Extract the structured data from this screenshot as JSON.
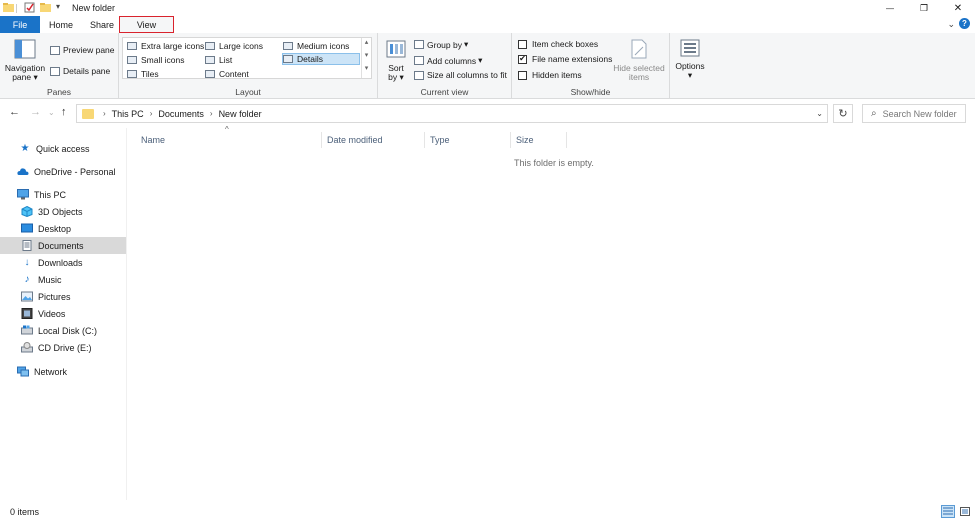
{
  "window": {
    "title": "New folder",
    "minimize": "—",
    "restore": "❐",
    "close": "✕"
  },
  "tabs": [
    {
      "label": "File"
    },
    {
      "label": "Home"
    },
    {
      "label": "Share"
    },
    {
      "label": "View"
    }
  ],
  "ribbon": {
    "collapse": "⌄",
    "help": "?",
    "panes": {
      "label": "Panes",
      "navigation_pane": "Navigation",
      "navigation_pane_2": "pane",
      "preview_pane": "Preview pane",
      "details_pane": "Details pane"
    },
    "layout": {
      "label": "Layout",
      "items": [
        {
          "label": "Extra large icons"
        },
        {
          "label": "Large icons"
        },
        {
          "label": "Medium icons"
        },
        {
          "label": "Small icons"
        },
        {
          "label": "List"
        },
        {
          "label": "Details"
        },
        {
          "label": "Tiles"
        },
        {
          "label": "Content"
        }
      ],
      "selected": "Details"
    },
    "current_view": {
      "label": "Current view",
      "sort_by": "Sort",
      "sort_by_2": "by",
      "group_by": "Group by",
      "add_columns": "Add columns",
      "size_columns": "Size all columns to fit"
    },
    "show_hide": {
      "label": "Show/hide",
      "item_check_boxes": "Item check boxes",
      "item_check_boxes_checked": false,
      "file_name_extensions": "File name extensions",
      "file_name_extensions_checked": true,
      "hidden_items": "Hidden items",
      "hidden_items_checked": false,
      "hide_selected": "Hide selected",
      "hide_selected_2": "items"
    },
    "options": {
      "label": "Options"
    }
  },
  "address": {
    "crumbs": [
      "This PC",
      "Documents",
      "New folder"
    ],
    "search_placeholder": "Search New folder"
  },
  "nav_pane": {
    "items": [
      {
        "label": "Quick access",
        "icon": "star-icon"
      },
      {
        "label": "OneDrive - Personal",
        "icon": "cloud-icon"
      },
      {
        "label": "This PC",
        "icon": "computer-icon"
      },
      {
        "label": "3D Objects",
        "icon": "cube-icon"
      },
      {
        "label": "Desktop",
        "icon": "desktop-icon"
      },
      {
        "label": "Documents",
        "icon": "documents-icon"
      },
      {
        "label": "Downloads",
        "icon": "download-icon"
      },
      {
        "label": "Music",
        "icon": "music-icon"
      },
      {
        "label": "Pictures",
        "icon": "pictures-icon"
      },
      {
        "label": "Videos",
        "icon": "videos-icon"
      },
      {
        "label": "Local Disk (C:)",
        "icon": "disk-icon"
      },
      {
        "label": "CD Drive (E:)",
        "icon": "cd-icon"
      },
      {
        "label": "Network",
        "icon": "network-icon"
      }
    ],
    "selected": "Documents"
  },
  "content": {
    "columns": [
      "Name",
      "Date modified",
      "Type",
      "Size"
    ],
    "empty_message": "This folder is empty."
  },
  "status": {
    "items_count": "0 items"
  },
  "colors": {
    "file_tab": "#1a73c8",
    "accent": "#1a73c8",
    "selected_bg": "#cce4f7",
    "highlight_border": "#d9232d"
  }
}
